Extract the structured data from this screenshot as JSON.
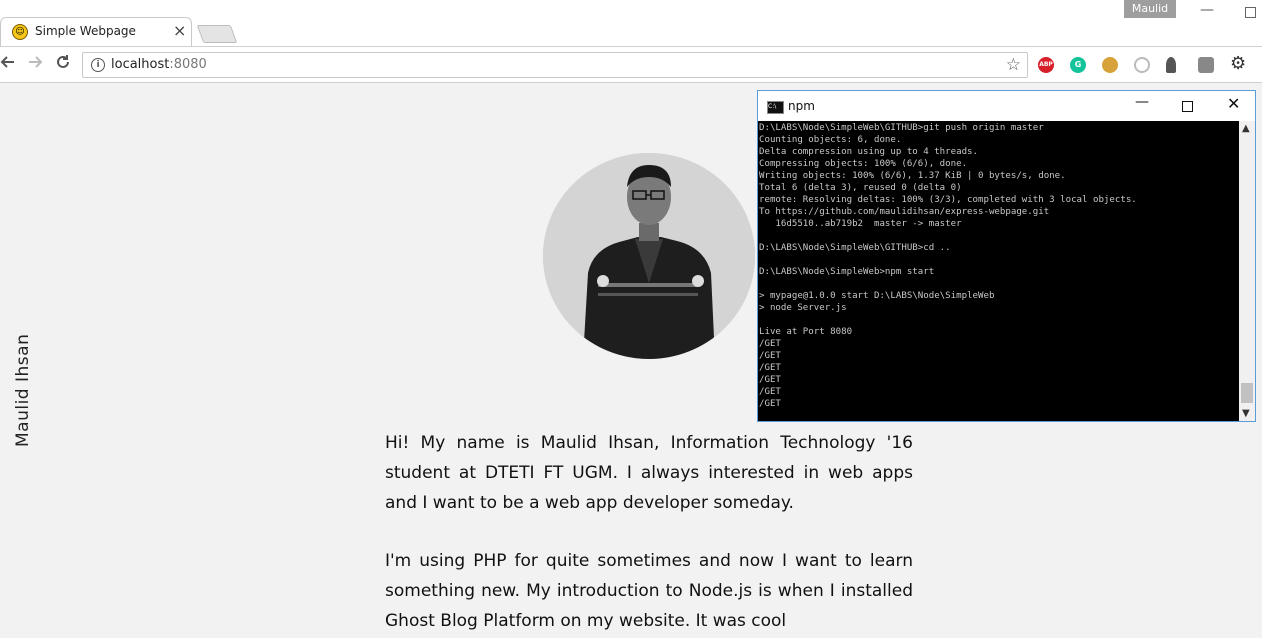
{
  "browser": {
    "tab_title": "Simple Webpage",
    "tab_close": "×",
    "profile_name": "Maulid",
    "window_minimize": "—",
    "url_host": "localhost",
    "url_port": ":8080",
    "back_icon": "arrow-left-icon",
    "forward_icon": "arrow-right-icon",
    "reload_icon": "reload-icon",
    "star_glyph": "☆",
    "extensions": [
      {
        "name": "adblock-plus-icon",
        "label": "ABP",
        "color": "#d8202a"
      },
      {
        "name": "grammarly-icon",
        "label": "G",
        "color": "#15c39a"
      },
      {
        "name": "cookie-icon",
        "label": "",
        "color": "#d8a23b"
      },
      {
        "name": "links-icon",
        "label": "",
        "color": "#bbbbbb"
      },
      {
        "name": "bulb-icon",
        "label": "",
        "color": "#555555"
      },
      {
        "name": "cube-icon",
        "label": "",
        "color": "#888888"
      },
      {
        "name": "gear-icon",
        "label": "⚙",
        "color": "#333333"
      }
    ]
  },
  "page": {
    "vertical_name": "Maulid Ihsan",
    "paragraphs": [
      "Hi! My name is Maulid Ihsan, Information Technology '16 student at DTETI FT UGM. I always interested in web apps and I want to be a web app developer someday.",
      "I'm using PHP for quite sometimes and now I want to learn something new. My introduction to Node.js is when I installed Ghost Blog Platform on my website. It was cool"
    ]
  },
  "console": {
    "title": "npm",
    "close_glyph": "✕",
    "minimize_glyph": "—",
    "output": "D:\\LABS\\Node\\SimpleWeb\\GITHUB>git push origin master\nCounting objects: 6, done.\nDelta compression using up to 4 threads.\nCompressing objects: 100% (6/6), done.\nWriting objects: 100% (6/6), 1.37 KiB | 0 bytes/s, done.\nTotal 6 (delta 3), reused 0 (delta 0)\nremote: Resolving deltas: 100% (3/3), completed with 3 local objects.\nTo https://github.com/maulidihsan/express-webpage.git\n   16d5510..ab719b2  master -> master\n\nD:\\LABS\\Node\\SimpleWeb\\GITHUB>cd ..\n\nD:\\LABS\\Node\\SimpleWeb>npm start\n\n> mypage@1.0.0 start D:\\LABS\\Node\\SimpleWeb\n> node Server.js\n\nLive at Port 8080\n/GET\n/GET\n/GET\n/GET\n/GET\n/GET"
  }
}
